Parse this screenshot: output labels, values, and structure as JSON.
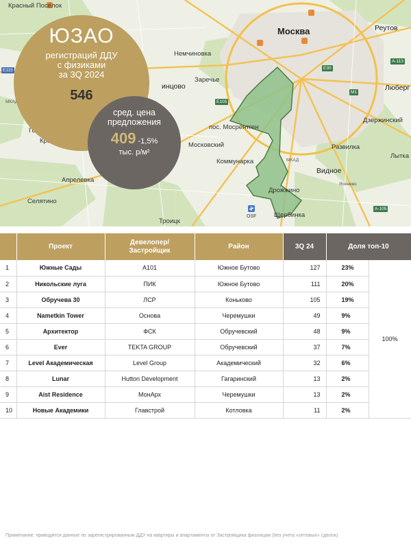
{
  "colors": {
    "gold": "#bd9f5f",
    "grey": "#6c6663",
    "district_fill": "#8fc18a",
    "district_stroke": "#4e7a44"
  },
  "map": {
    "labels": {
      "krasny_posyolok": "Красный Посёлок",
      "moscow": "Москва",
      "reutov": "Реутов",
      "nemchinovka": "Немчиновка",
      "odintsovo": "инцово",
      "zarechye": "Заречье",
      "lyubertsy": "Люберг",
      "dzerzhinsky": "Дзержинский",
      "golitsyno": "Голиц",
      "krasnoznamensk": "Краснознамен",
      "mosrentgen": "пос. Мосрентген",
      "moskovsky": "Московский",
      "razvilka": "Развилка",
      "lytkarino": "Лытка",
      "kommunarka": "Коммунарка",
      "vidnoe": "Видное",
      "aprelevka": "Апрелевка",
      "drozhzhino": "Дрожжино",
      "selyatino": "Селятино",
      "shcherbinka": "Щербинка",
      "troitsk": "Троицк",
      "vnukovo_label": "OSF",
      "e105": "E105",
      "e30": "E30",
      "m1": "M1",
      "a105": "А-105",
      "e115": "E115",
      "a113": "A-113",
      "mkad": "МКАД",
      "mkad2": "МКАД",
      "yasenevo": "Ясенево"
    }
  },
  "summary": {
    "district": "ЮЗАО",
    "registrations_caption": "регистраций ДДУ\nс физиками\nза 3Q 2024",
    "registrations_value": "546",
    "price_caption": "сред. цена\nпредложения",
    "price_value": "409",
    "price_change": "-1,5%",
    "price_unit": "тыс. р/м²"
  },
  "table": {
    "headers": {
      "project": "Проект",
      "developer": "Девелопер/\nЗастройщик",
      "district": "Район",
      "q": "3Q 24",
      "share": "Доля топ-10"
    },
    "total_share": "100%",
    "rows": [
      {
        "n": "1",
        "project": "Южные Сады",
        "developer": "А101",
        "district": "Южное Бутово",
        "q": "127",
        "share": "23%"
      },
      {
        "n": "2",
        "project": "Никольские луга",
        "developer": "ПИК",
        "district": "Южное Бутово",
        "q": "111",
        "share": "20%"
      },
      {
        "n": "3",
        "project": "Обручева 30",
        "developer": "ЛСР",
        "district": "Коньково",
        "q": "105",
        "share": "19%"
      },
      {
        "n": "4",
        "project": "Nametkin Tower",
        "developer": "Основа",
        "district": "Черемушки",
        "q": "49",
        "share": "9%"
      },
      {
        "n": "5",
        "project": "Архитектор",
        "developer": "ФСК",
        "district": "Обручевский",
        "q": "48",
        "share": "9%"
      },
      {
        "n": "6",
        "project": "Ever",
        "developer": "TEKTA GROUP",
        "district": "Обручевский",
        "q": "37",
        "share": "7%"
      },
      {
        "n": "7",
        "project": "Level Академическая",
        "developer": "Level Group",
        "district": "Академический",
        "q": "32",
        "share": "6%"
      },
      {
        "n": "8",
        "project": "Lunar",
        "developer": "Hutton Development",
        "district": "Гагаринский",
        "q": "13",
        "share": "2%"
      },
      {
        "n": "9",
        "project": "Aist Residence",
        "developer": "МонАрх",
        "district": "Черемушки",
        "q": "13",
        "share": "2%"
      },
      {
        "n": "10",
        "project": "Новые Академики",
        "developer": "Главстрой",
        "district": "Котловка",
        "q": "11",
        "share": "2%"
      }
    ]
  },
  "footnote": "Примечание: приводятся данные по зарегистрированным ДДУ на квартиры и апартаменты от Застройщика физлицам (без учета «оптовых» сделок)"
}
